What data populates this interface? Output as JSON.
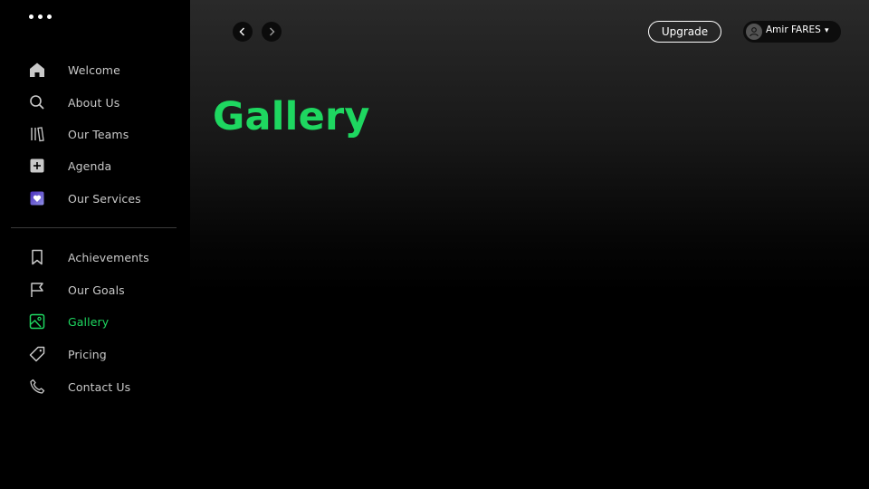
{
  "menu": {
    "icon": "more-horizontal-icon"
  },
  "sidebar": {
    "top_items": [
      {
        "label": "Welcome",
        "icon": "home-icon"
      },
      {
        "label": "About Us",
        "icon": "search-icon"
      },
      {
        "label": "Our  Teams",
        "icon": "library-icon"
      },
      {
        "label": "Agenda",
        "icon": "plus-square-icon"
      },
      {
        "label": "Our Services",
        "icon": "heart-square-icon"
      }
    ],
    "bottom_items": [
      {
        "label": "Achievements",
        "icon": "bookmark-icon"
      },
      {
        "label": "Our Goals",
        "icon": "flag-icon"
      },
      {
        "label": "Gallery",
        "icon": "image-icon",
        "active": true
      },
      {
        "label": "Pricing",
        "icon": "tag-icon"
      },
      {
        "label": "Contact Us",
        "icon": "phone-icon"
      }
    ]
  },
  "header": {
    "back_icon": "chevron-left-icon",
    "forward_icon": "chevron-right-icon",
    "upgrade_label": "Upgrade",
    "user_name": "Amir FARES",
    "user_icon": "user-icon",
    "caret_icon": "caret-down-icon",
    "caret": "▾"
  },
  "page": {
    "title": "Gallery"
  },
  "colors": {
    "accent": "#1ed760",
    "background": "#000000",
    "text": "#ffffff",
    "muted_text": "#c9c9c9"
  }
}
